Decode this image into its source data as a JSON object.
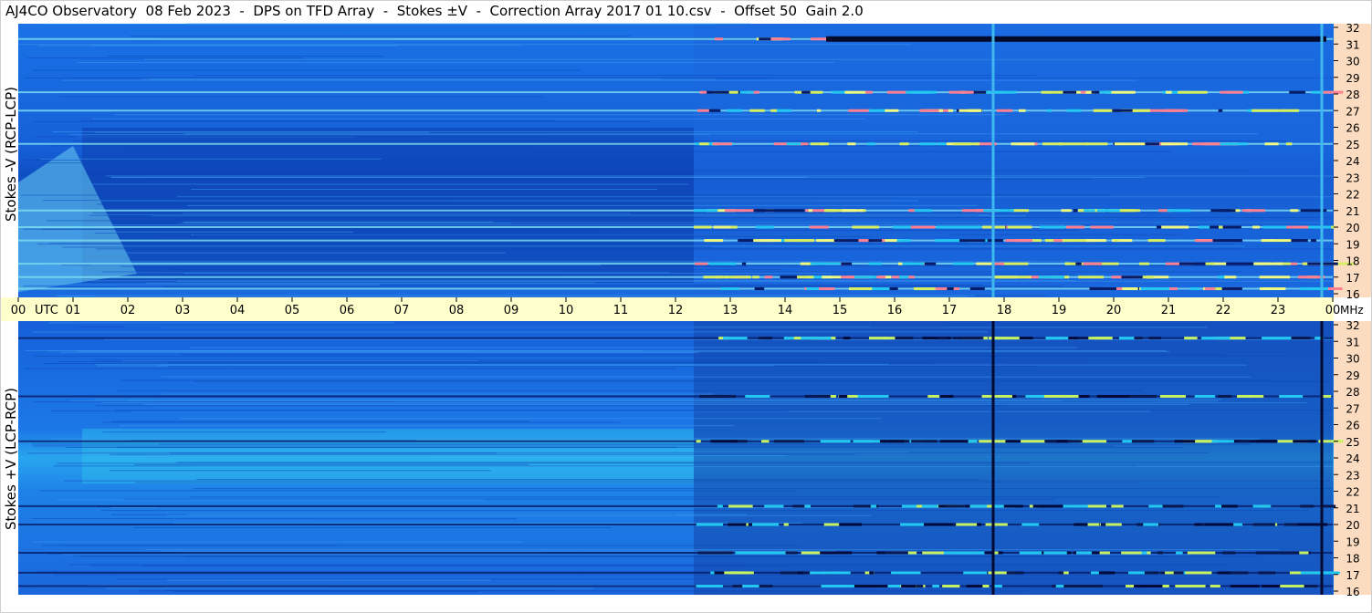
{
  "header": {
    "title": "AJ4CO Observatory  08 Feb 2023  -  DPS on TFD Array  -  Stokes ±V  -  Correction Array 2017 01 10.csv  -  Offset 50  Gain 2.0"
  },
  "colors": {
    "background_blue": "#1a6fe8",
    "dark_blue": "#0b3a9e",
    "cyan": "#22c4f0",
    "yellow_green": "#c8f060",
    "time_axis_band": "#ffffcc",
    "mhz_axis_band": "#fcdcc0"
  },
  "chart_data": {
    "type": "heatmap",
    "title": "AJ4CO Observatory  08 Feb 2023  -  DPS on TFD Array  -  Stokes ±V  -  Correction Array 2017 01 10.csv  -  Offset 50  Gain 2.0",
    "x_axis": {
      "label": "UTC",
      "range": [
        0,
        24
      ],
      "tick_labels": [
        "00",
        "01",
        "02",
        "03",
        "04",
        "05",
        "06",
        "07",
        "08",
        "09",
        "10",
        "11",
        "12",
        "13",
        "14",
        "15",
        "16",
        "17",
        "18",
        "19",
        "20",
        "21",
        "22",
        "23",
        "00"
      ]
    },
    "y_axis": {
      "unit": "MHz",
      "range": [
        16,
        32
      ],
      "tick_labels": [
        "32",
        "31",
        "30",
        "29",
        "28",
        "27",
        "26",
        "25",
        "24",
        "23",
        "22",
        "21",
        "20",
        "19",
        "18",
        "17",
        "16"
      ]
    },
    "panels": [
      {
        "ylabel": "Stokes -V (RCP-LCP)",
        "vertical_lines_utc": [
          17.75,
          23.8
        ],
        "strong_rfi_bands_mhz": [
          31.3,
          28.1,
          27.0,
          25.0,
          21.0,
          20.0,
          19.2,
          17.8,
          17.0,
          16.3
        ]
      },
      {
        "ylabel": "Stokes +V (LCP-RCP)",
        "vertical_lines_utc": [
          17.75,
          23.8
        ],
        "strong_rfi_bands_mhz": [
          31.2,
          27.7,
          25.0,
          21.1,
          20.0,
          18.3,
          17.1,
          16.3
        ]
      }
    ]
  }
}
